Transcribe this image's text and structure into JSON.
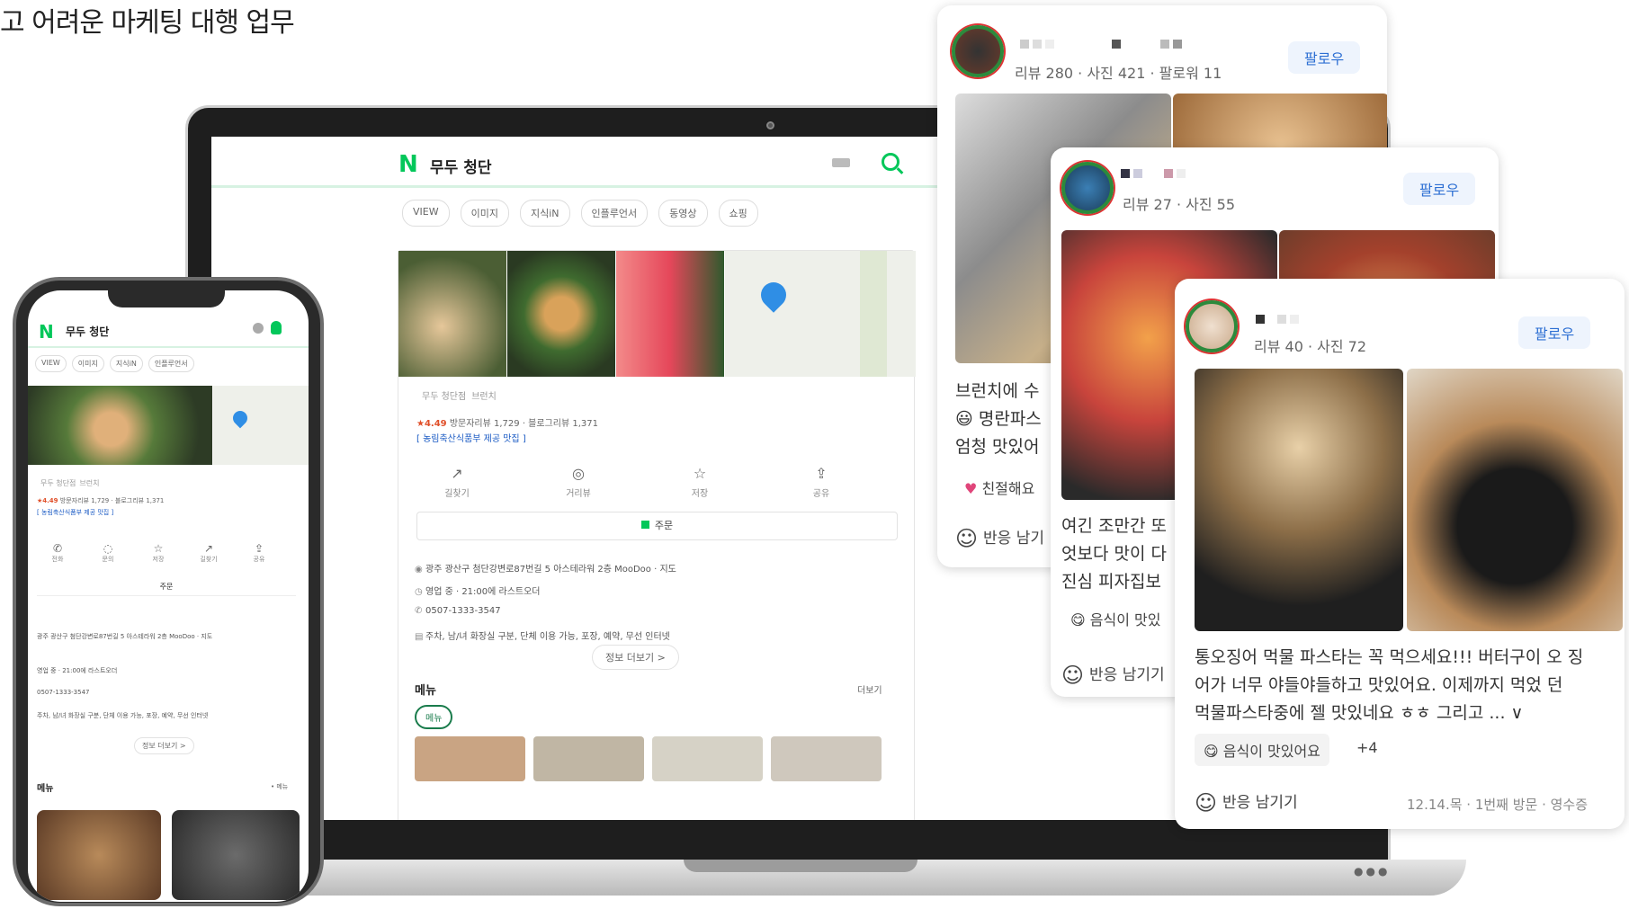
{
  "headline": "고 어려운 마케팅 대행 업무",
  "search": {
    "logo": "N",
    "query": "무두 청단",
    "tabs": [
      "VIEW",
      "이미지",
      "지식iN",
      "인플루언서",
      "동영상",
      "쇼핑"
    ]
  },
  "place": {
    "name": "무두 청단점",
    "category": "브런치",
    "rating": "★4.49",
    "reviews": "방문자리뷰 1,729 · 블로그리뷰 1,371",
    "badge": "[ 농림축산식품부 제공 맛집 ]",
    "actions": [
      "길찾기",
      "거리뷰",
      "저장",
      "공유"
    ],
    "order_label": "주문",
    "address": "광주 광산구 첨단강변로87번길 5 아스테라워 2층 MooDoo · 지도",
    "hours": "영업 중 · 21:00에 라스트오더",
    "phone": "0507-1333-3547",
    "amenities": "주차, 남/녀 화장실 구분, 단체 이용 가능, 포장, 예약, 무선 인터넷",
    "more_info": "정보 더보기 >",
    "menu_title": "메뉴",
    "menu_more": "더보기",
    "menu_pill": "메뉴"
  },
  "phone_view": {
    "tabs": [
      "VIEW",
      "이미지",
      "지식iN",
      "인플루언서"
    ],
    "actions": [
      "전화",
      "문의",
      "저장",
      "길찾기",
      "공유"
    ],
    "menu_count": "• 메뉴"
  },
  "reviews": [
    {
      "stats": "리뷰 280 · 사진 421 · 팔로워 11",
      "follow": "팔로우",
      "lines": [
        "브런치에 수",
        "명란파스",
        "엄청 맛있어"
      ],
      "tag": "친절해요",
      "react": "반응 남기"
    },
    {
      "stats": "리뷰 27 · 사진 55",
      "follow": "팔로우",
      "lines": [
        "여긴 조만간 또",
        "엇보다 맛이 다",
        "진심 피자집보"
      ],
      "tag": "음식이 맛있",
      "react": "반응 남기기"
    },
    {
      "stats": "리뷰 40 · 사진 72",
      "follow": "팔로우",
      "lines": [
        "통오징어 먹물 파스타는 꼭 먹으세요!!! 버터구이 오 징",
        "어가 너무 야들야들하고 맛있어요. 이제까지 먹었 던",
        "먹물파스타중에 젤 맛있네요 ㅎㅎ 그리고 ... ∨"
      ],
      "tag": "음식이 맛있어요",
      "tag_extra": "+4",
      "react": "반응 남기기",
      "date": "12.14.목 · 1번째 방문 · 영수증"
    }
  ],
  "colors": {
    "naver_green": "#03c75a",
    "follow_blue": "#2d6fd3"
  }
}
